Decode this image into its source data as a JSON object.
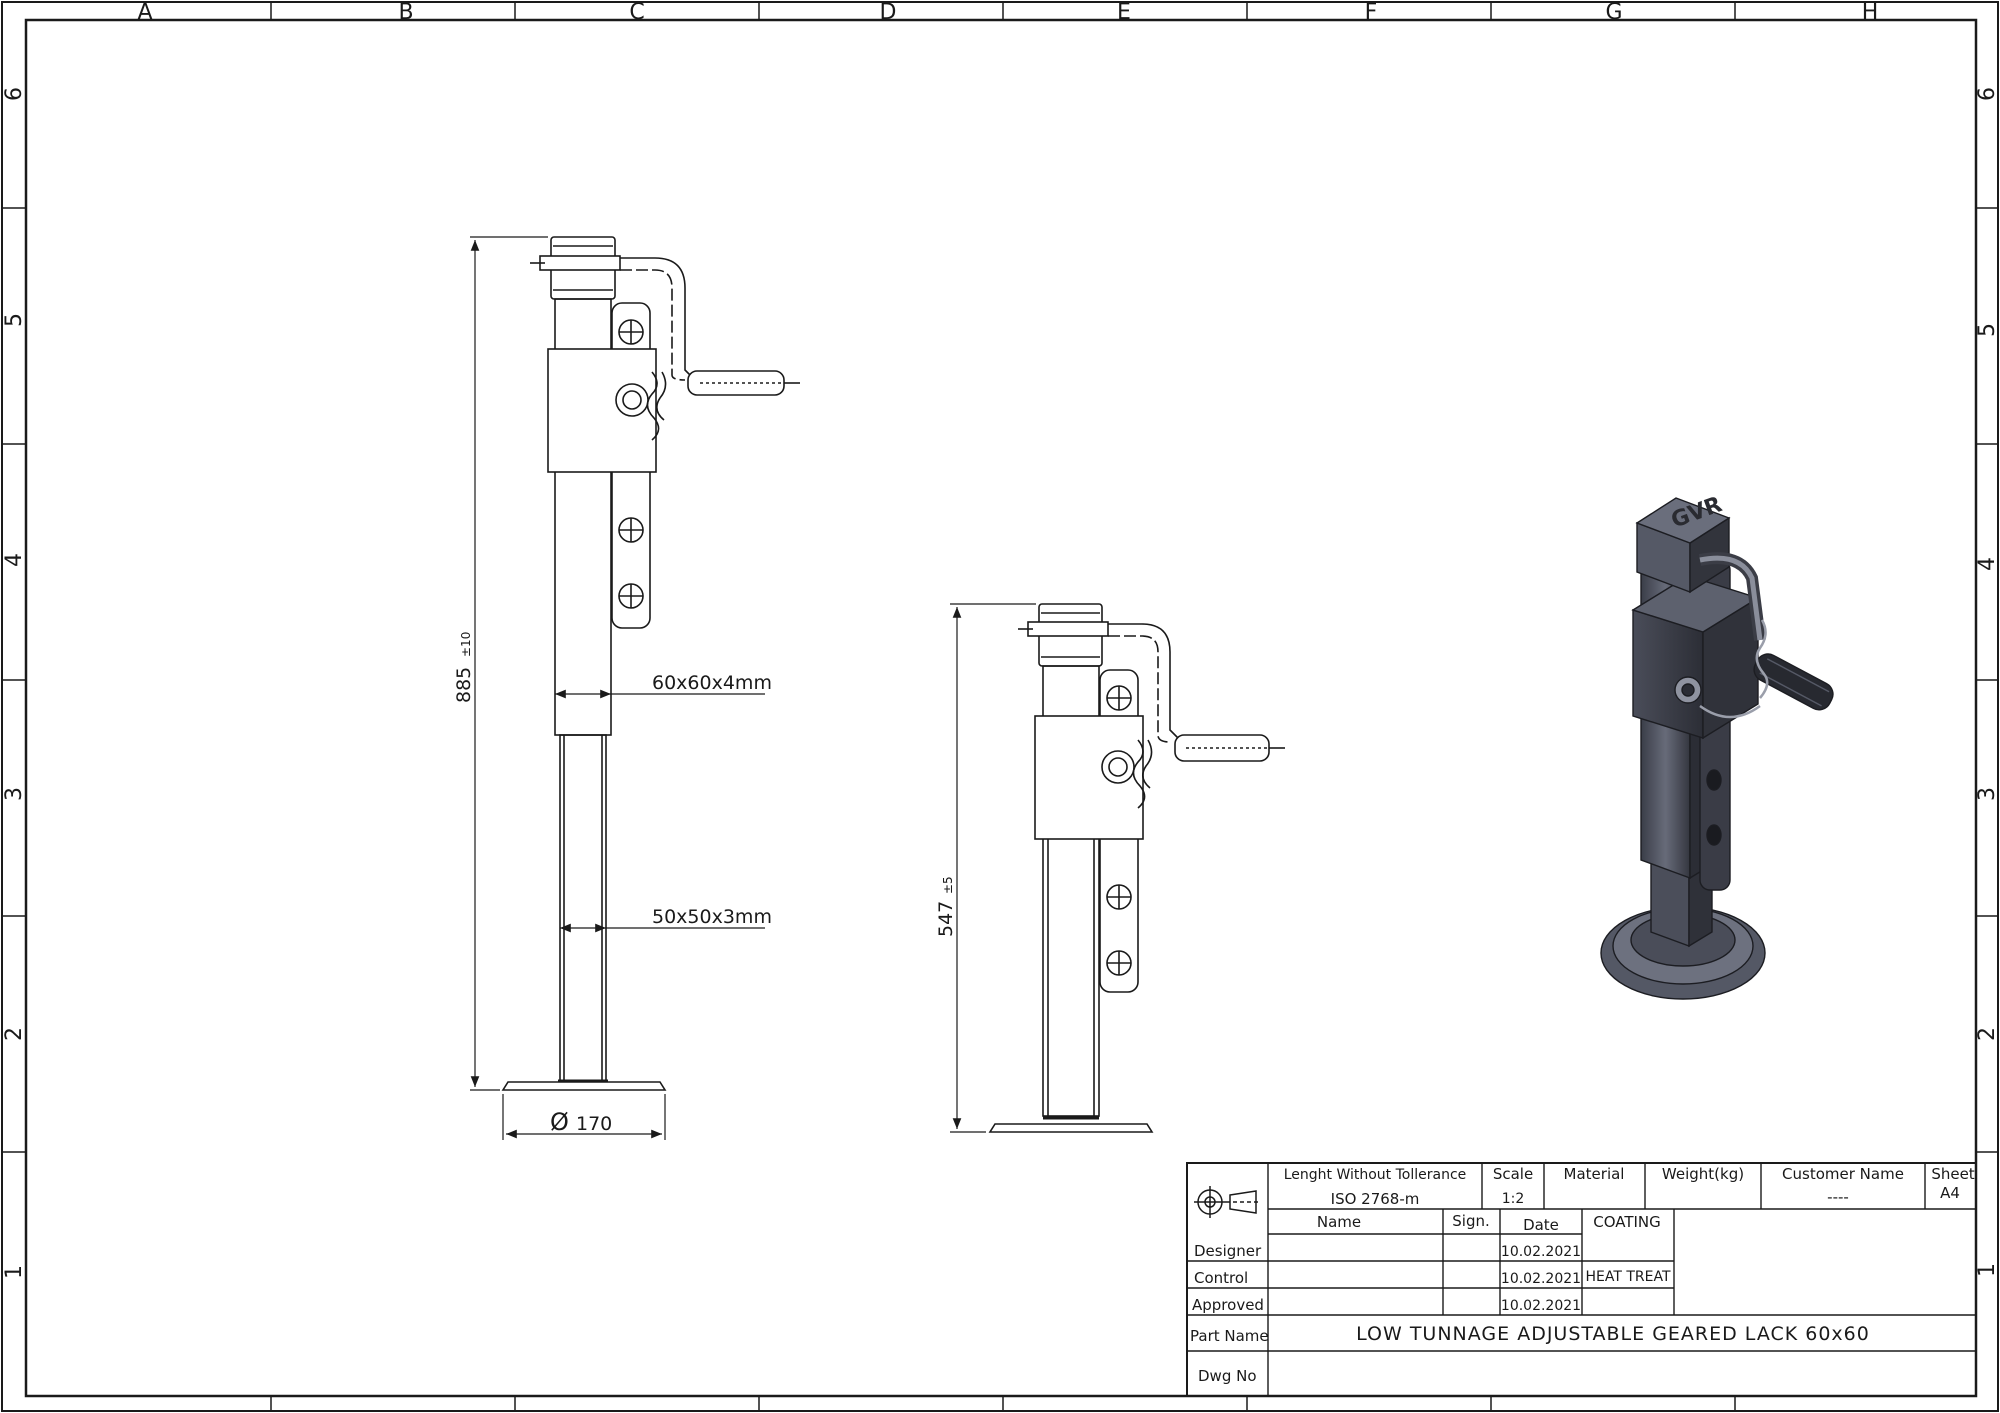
{
  "border": {
    "columns": [
      "A",
      "B",
      "C",
      "D",
      "E",
      "F",
      "G",
      "H"
    ],
    "rows": [
      "6",
      "5",
      "4",
      "3",
      "2",
      "1"
    ]
  },
  "views": {
    "front": {
      "overall_height": "885",
      "overall_tol": "±10",
      "outer_tube": "60x60x4mm",
      "inner_tube": "50x50x3mm",
      "foot_diameter": "170",
      "diameter_symbol": "Ø"
    },
    "side": {
      "retracted_height": "547",
      "retracted_tol": "±5"
    },
    "iso": {
      "brand_mark": "GVR"
    }
  },
  "title_block": {
    "tolerance_title": "Lenght Without Tollerance",
    "tolerance_std": "ISO 2768-m",
    "scale_label": "Scale",
    "scale_value": "1:2",
    "material_label": "Material",
    "material_value": "",
    "weight_label": "Weight(kg)",
    "weight_value": "",
    "customer_label": "Customer Name",
    "customer_value": "----",
    "sheet_label": "Sheet",
    "sheet_value": "A4",
    "col_name": "Name",
    "col_sign": "Sign.",
    "col_date": "Date",
    "coating_label": "COATING",
    "heat_treat_label": "HEAT TREAT",
    "rows": [
      {
        "role": "Designer",
        "name": "",
        "sign": "",
        "date": "10.02.2021"
      },
      {
        "role": "Control",
        "name": "",
        "sign": "",
        "date": "10.02.2021"
      },
      {
        "role": "Approved",
        "name": "",
        "sign": "",
        "date": "10.02.2021"
      }
    ],
    "part_name_label": "Part Name",
    "part_name": "LOW TUNNAGE ADJUSTABLE GEARED LACK 60x60",
    "dwg_no_label": "Dwg No",
    "dwg_no": "",
    "projection_symbol": "first-angle-projection-icon"
  }
}
